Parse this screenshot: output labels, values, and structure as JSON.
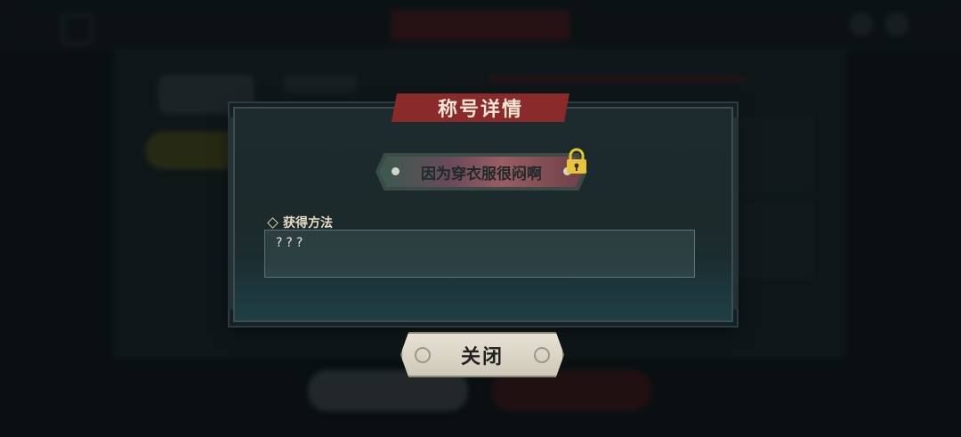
{
  "dialog": {
    "title": "称号详情",
    "badge_text": "因为穿衣服很闷啊",
    "method_label": "获得方法",
    "method_value": "???",
    "close_label": "关闭"
  },
  "icons": {
    "lock": "lock-icon",
    "diamond": "diamond-icon"
  },
  "colors": {
    "ribbon": "#8b2a2a",
    "lock": "#e8c43a",
    "close_button": "#dcd6c6"
  }
}
